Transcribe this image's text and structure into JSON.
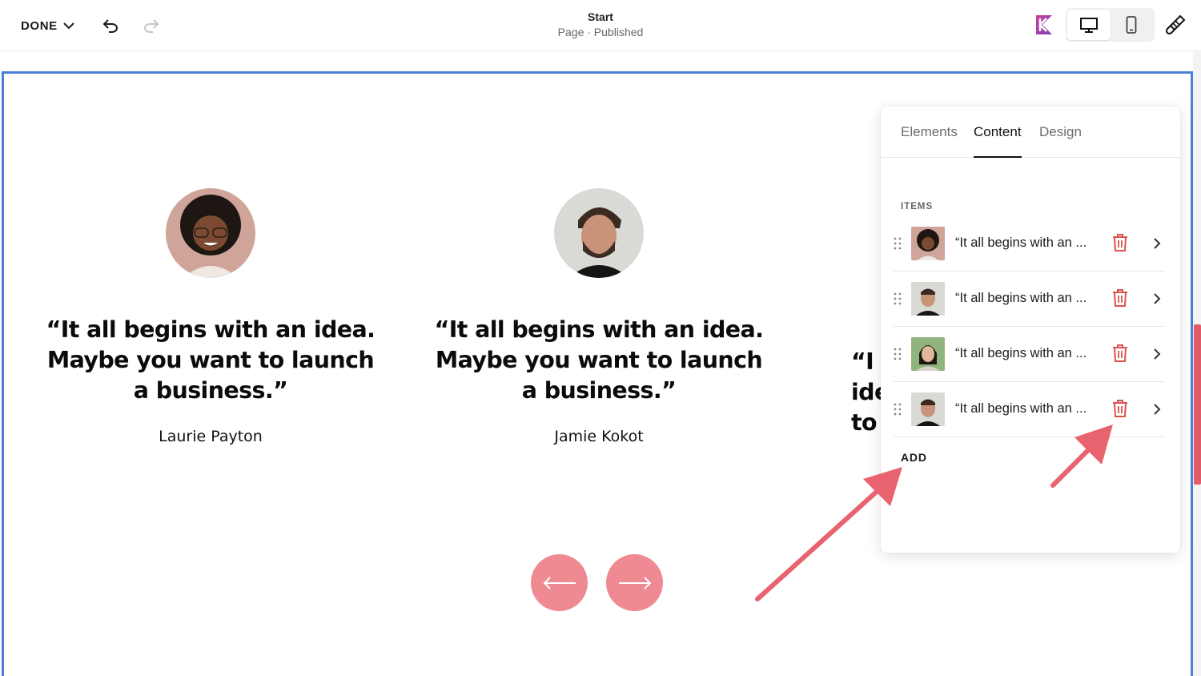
{
  "toolbar": {
    "done_label": "DONE",
    "page_title": "Start",
    "page_status": "Page · Published"
  },
  "testimonials": [
    {
      "quote": "“It all begins with an idea. Maybe you want to launch a business.”",
      "author": "Laurie Payton"
    },
    {
      "quote": "“It all begins with an idea. Maybe you want to launch a business.”",
      "author": "Jamie Kokot"
    },
    {
      "quote": "“I idea to"
    }
  ],
  "panel": {
    "tabs": [
      {
        "label": "Elements"
      },
      {
        "label": "Content"
      },
      {
        "label": "Design"
      }
    ],
    "active_tab": "Content",
    "items_label": "ITEMS",
    "items": [
      {
        "text": "“It all begins with an ..."
      },
      {
        "text": "“It all begins with an ..."
      },
      {
        "text": "“It all begins with an ..."
      },
      {
        "text": "“It all begins with an ..."
      }
    ],
    "add_label": "ADD"
  },
  "colors": {
    "accent_pink": "#ef8a93",
    "annotation_arrow": "#e8636f",
    "selection_border": "#4b7fd6",
    "trash_icon": "#d9534f"
  },
  "icons": [
    "chevron-down-icon",
    "undo-icon",
    "redo-icon",
    "brand-logo-icon",
    "desktop-icon",
    "mobile-icon",
    "brush-icon",
    "drag-handle-icon",
    "trash-icon",
    "chevron-right-icon",
    "arrow-left-icon",
    "arrow-right-icon"
  ]
}
